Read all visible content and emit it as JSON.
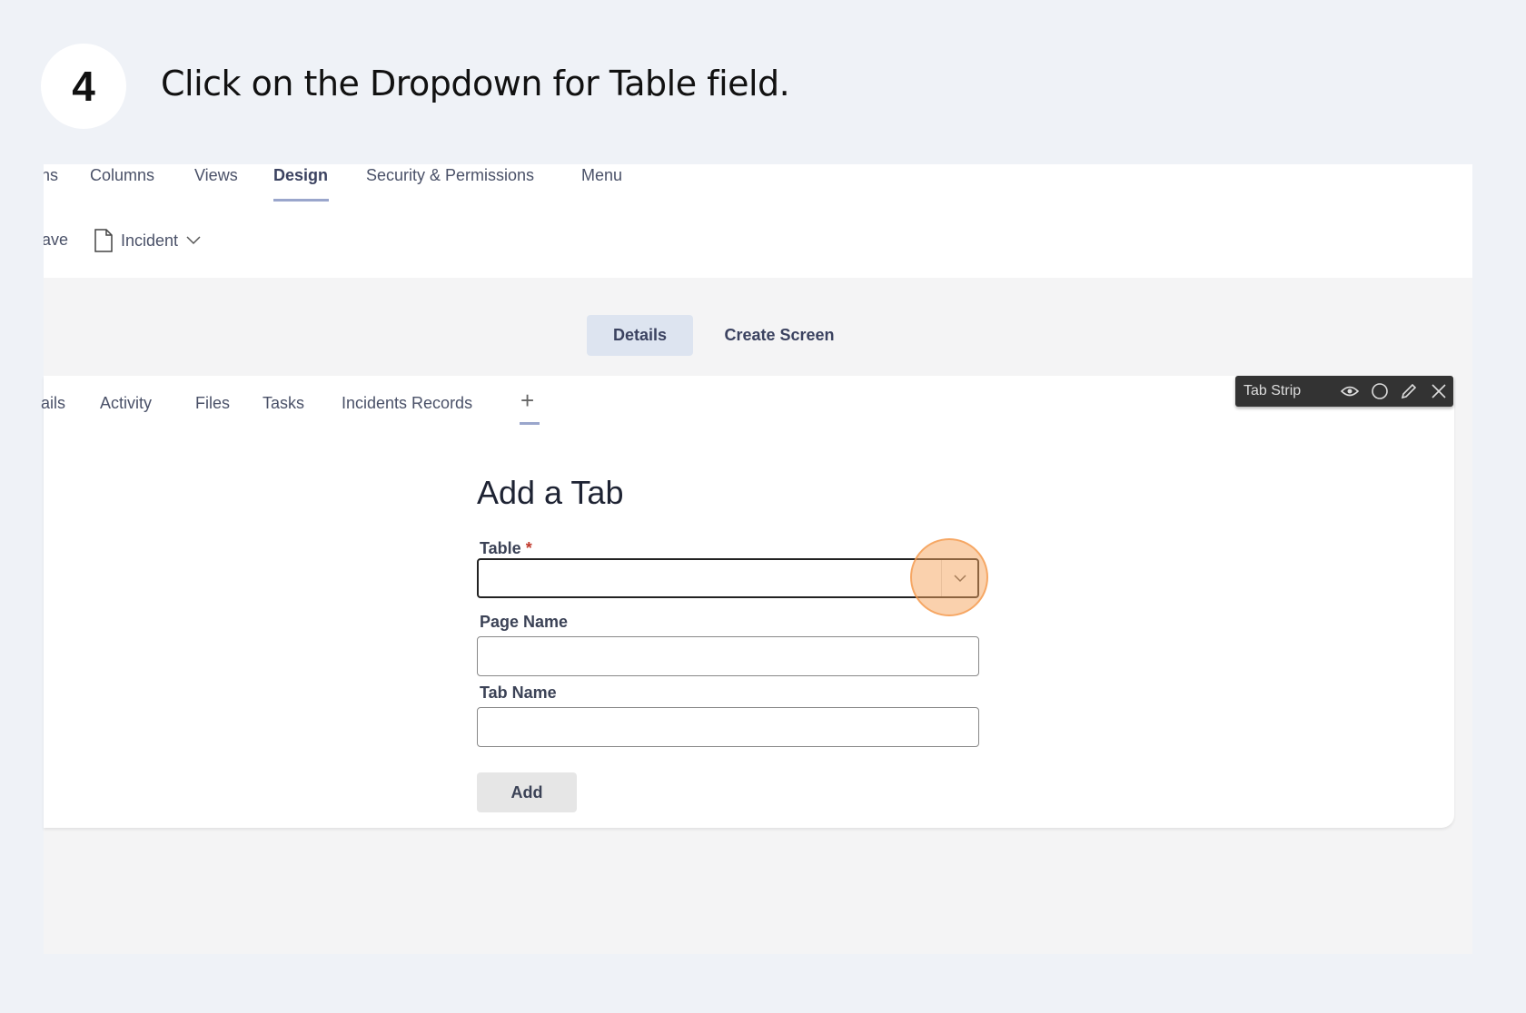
{
  "step": {
    "number": "4",
    "instruction": "Click on the Dropdown for Table field."
  },
  "top_tabs": [
    {
      "label": "ns"
    },
    {
      "label": "Columns"
    },
    {
      "label": "Views"
    },
    {
      "label": "Design",
      "active": true
    },
    {
      "label": "Security & Permissions"
    },
    {
      "label": "Menu"
    }
  ],
  "toolbar_row": {
    "save_label": "ave",
    "page_label": "Incident",
    "page_icon": "file-icon"
  },
  "segments": [
    {
      "label": "Details",
      "active": true
    },
    {
      "label": "Create Screen"
    }
  ],
  "card_tabs": [
    {
      "label": "ails"
    },
    {
      "label": "Activity"
    },
    {
      "label": "Files"
    },
    {
      "label": "Tasks"
    },
    {
      "label": "Incidents Records"
    }
  ],
  "add_tab_symbol": "+",
  "tab_strip_toolbar": {
    "label": "Tab Strip",
    "icons": [
      "eye-icon",
      "circle-icon",
      "pencil-icon",
      "close-icon"
    ]
  },
  "form": {
    "title": "Add a Tab",
    "table_label": "Table",
    "required_mark": "*",
    "table_value": "",
    "page_name_label": "Page Name",
    "page_name_value": "",
    "tab_name_label": "Tab Name",
    "tab_name_value": "",
    "add_label": "Add"
  },
  "colors": {
    "highlight": "#f5a35c",
    "active_segment": "#dde4f0",
    "required": "#c0392b"
  }
}
